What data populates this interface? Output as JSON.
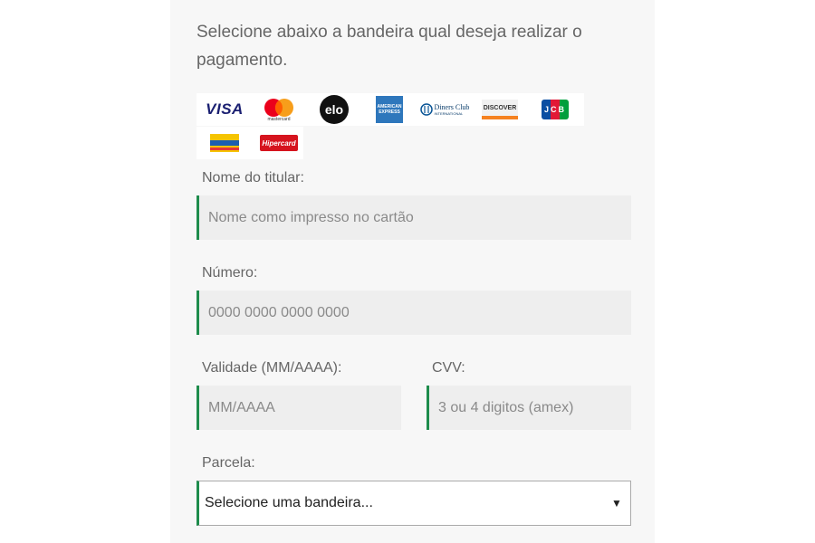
{
  "intro": {
    "line1": "Selecione abaixo a bandeira qual deseja realizar o",
    "line2": "pagamento."
  },
  "brands": {
    "visa": "VISA",
    "mastercard_caption": "mastercard",
    "elo": "elo",
    "amex_line1": "AMERICAN",
    "amex_line2": "EXPRESS",
    "diners": "Diners Club",
    "diners_sub": "INTERNATIONAL",
    "discover": "DISCOVER",
    "jcb": "JCB",
    "hipercard": "Hipercard",
    "colors": {
      "visa": "#1a1f71",
      "mastercard_red": "#eb001b",
      "mastercard_yellow": "#f79e1b",
      "elo": "#111111",
      "amex": "#2e77bc",
      "discover_orange": "#f58220",
      "jcb_blue": "#0b4ea2",
      "jcb_red": "#e21836",
      "jcb_green": "#009f3c",
      "hipercard": "#d6141e",
      "banese_yellow": "#f5c400",
      "banese_blue": "#1b5eb0"
    }
  },
  "form": {
    "holder_label": "Nome do titular:",
    "holder_placeholder": "Nome como impresso no cartão",
    "number_label": "Número:",
    "number_placeholder": "0000 0000 0000 0000",
    "expiry_label": "Validade (MM/AAAA):",
    "expiry_placeholder": "MM/AAAA",
    "cvv_label": "CVV:",
    "cvv_placeholder": "3 ou 4 digitos (amex)",
    "installments_label": "Parcela:",
    "installments_value": "Selecione uma bandeira...",
    "installments_caret": "▼"
  },
  "theme": {
    "accent": "#1e8c4c",
    "field_bg": "#eeeeee",
    "panel_bg": "#f7f7f7"
  }
}
